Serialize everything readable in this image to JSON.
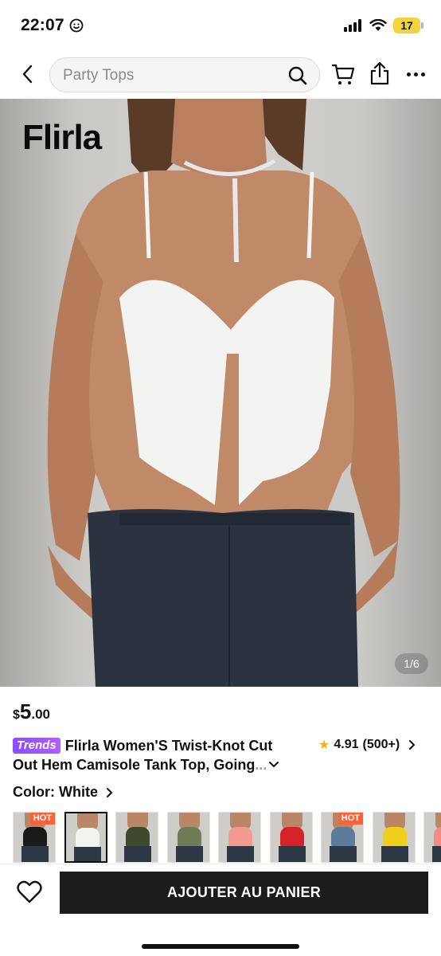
{
  "status_bar": {
    "time": "22:07",
    "battery": "17"
  },
  "search": {
    "placeholder": "Party Tops"
  },
  "product": {
    "brand": "Flirla",
    "image_page": "1/6",
    "price": {
      "currency": "$",
      "integer": "5",
      "decimal": ".00"
    },
    "trend_badge": "Trends",
    "title_line1": "Flirla Women'S Twist-Knot Cut",
    "title_line2": "Out Hem Camisole Tank Top, Going",
    "title_ellipsis": "...",
    "rating": "4.91",
    "review_count": "(500+)",
    "color_label": "Color:",
    "color_value": "White"
  },
  "swatches": [
    {
      "color": "#1a1a1a",
      "hot": "HOT",
      "selected": false
    },
    {
      "color": "#f2f2ef",
      "hot": "",
      "selected": true
    },
    {
      "color": "#3f4a2a",
      "hot": "",
      "selected": false
    },
    {
      "color": "#6f7c5a",
      "hot": "",
      "selected": false
    },
    {
      "color": "#f29b93",
      "hot": "",
      "selected": false
    },
    {
      "color": "#d6232a",
      "hot": "",
      "selected": false
    },
    {
      "color": "#5c7d99",
      "hot": "HOT",
      "selected": false
    },
    {
      "color": "#f1cf1d",
      "hot": "",
      "selected": false
    },
    {
      "color": "#f28a86",
      "hot": "",
      "selected": false
    }
  ],
  "bottom_bar": {
    "add_to_cart": "AJOUTER AU PANIER"
  },
  "colors": {
    "accent_hot": "#fa6338",
    "trends": "#8a4dff",
    "star": "#f5b400",
    "button": "#1c1c1c"
  }
}
